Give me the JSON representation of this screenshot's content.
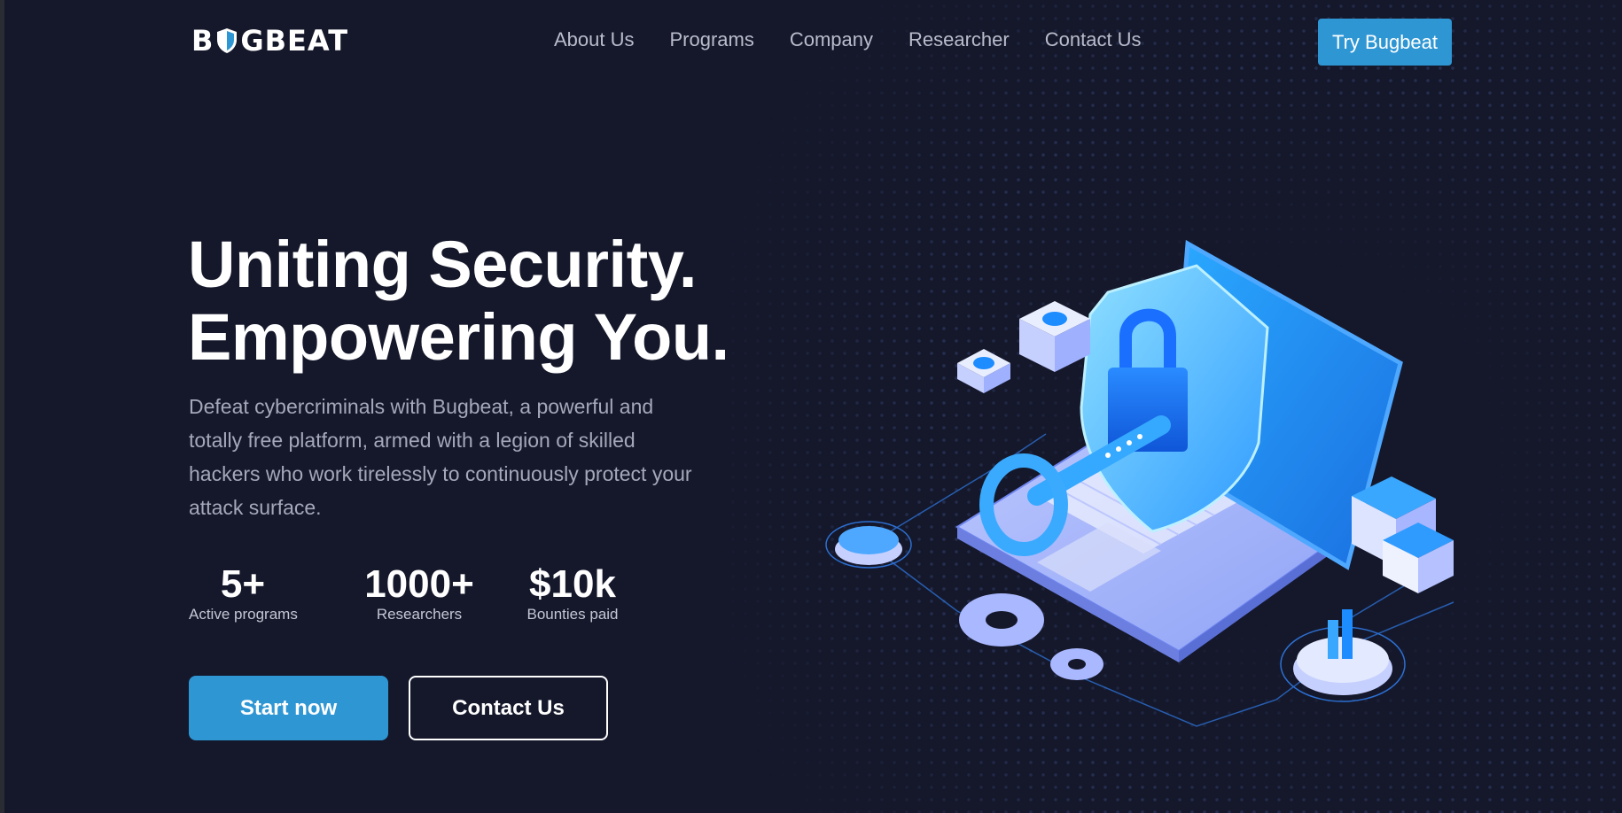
{
  "header": {
    "logo_text_left": "B",
    "logo_text_right": "GBEAT",
    "nav": [
      {
        "label": "About Us"
      },
      {
        "label": "Programs"
      },
      {
        "label": "Company"
      },
      {
        "label": "Researcher"
      },
      {
        "label": "Contact Us"
      }
    ],
    "cta_label": "Try Bugbeat"
  },
  "hero": {
    "headline_line1": "Uniting Security.",
    "headline_line2": "Empowering You.",
    "description": "Defeat cybercriminals with Bugbeat, a powerful and totally free platform, armed with a legion of skilled hackers who work tirelessly to continuously protect your attack surface.",
    "stats": [
      {
        "value": "5+",
        "label": "Active programs"
      },
      {
        "value": "1000+",
        "label": "Researchers"
      },
      {
        "value": "$10k",
        "label": "Bounties paid"
      }
    ],
    "primary_button": "Start now",
    "secondary_button": "Contact Us"
  },
  "theme": {
    "background": "#15182b",
    "accent": "#2f96d4",
    "nav_text": "#b9bccb",
    "body_text": "#a4a8b9"
  },
  "icons": {
    "logo_shield": "shield-icon",
    "illustration": "laptop-shield-key-illustration"
  }
}
